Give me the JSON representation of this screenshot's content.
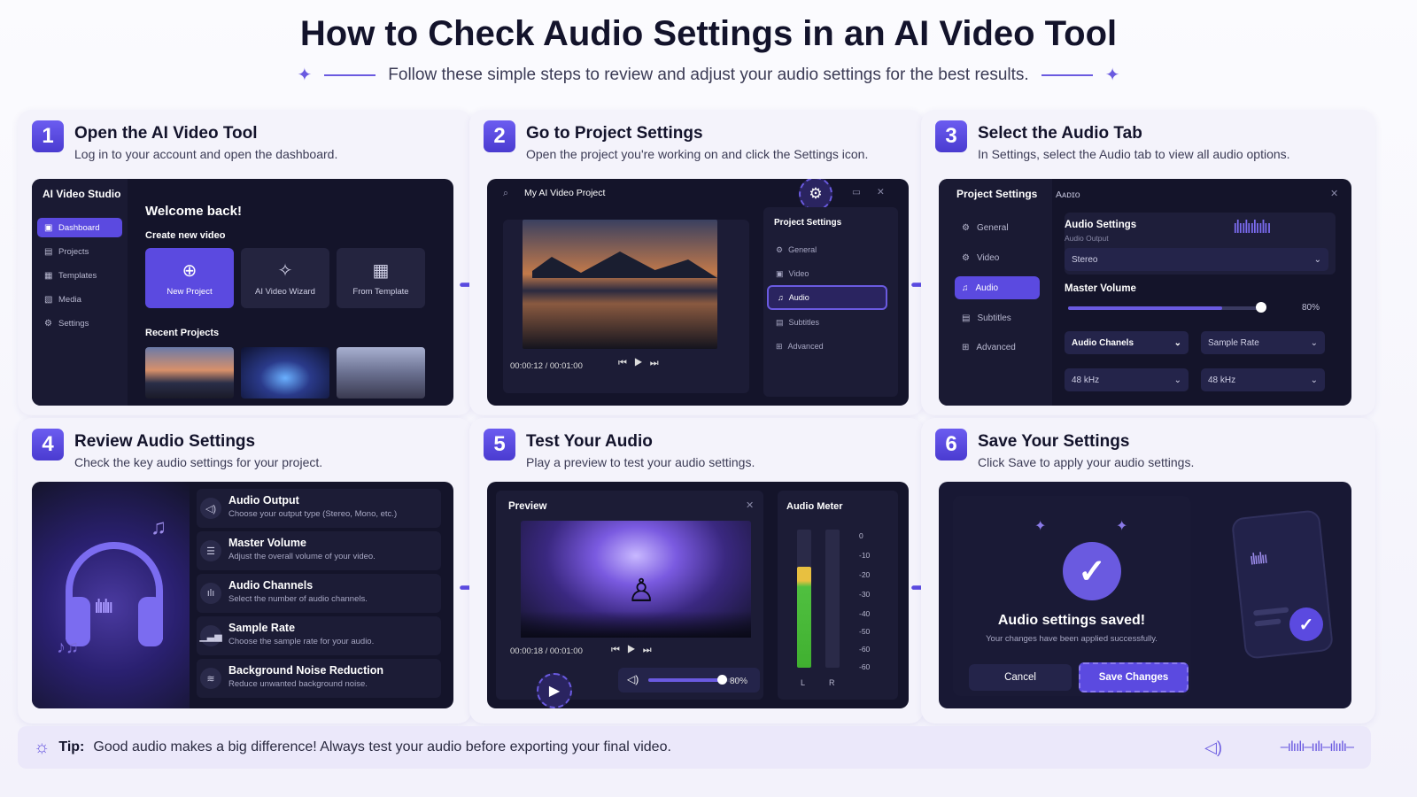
{
  "header": {
    "title": "How to Check Audio Settings in an AI Video Tool",
    "subtitle": "Follow these simple steps to review and adjust your audio settings for the best results."
  },
  "steps": [
    {
      "num": "1",
      "title": "Open the AI Video Tool",
      "desc": "Log in to your account and open the dashboard."
    },
    {
      "num": "2",
      "title": "Go to Project Settings",
      "desc": "Open the project you're working on and click the Settings icon."
    },
    {
      "num": "3",
      "title": "Select the Audio Tab",
      "desc": "In Settings, select the Audio tab to view all audio options."
    },
    {
      "num": "4",
      "title": "Review Audio Settings",
      "desc": "Check the key audio settings for your project."
    },
    {
      "num": "5",
      "title": "Test Your Audio",
      "desc": "Play a preview to test your audio settings."
    },
    {
      "num": "6",
      "title": "Save Your Settings",
      "desc": "Click Save to apply your audio settings."
    }
  ],
  "panel1": {
    "brand": "AI Video Studio",
    "nav": [
      "Dashboard",
      "Projects",
      "Templates",
      "Media",
      "Settings"
    ],
    "welcome": "Welcome back!",
    "create_label": "Create new video",
    "tiles": [
      "New Project",
      "AI Video Wizard",
      "From Template"
    ],
    "recent_label": "Recent Projects"
  },
  "panel2": {
    "project_title": "My AI Video Project",
    "time": "00:00:12 / 00:01:00",
    "settings_title": "Project Settings",
    "items": [
      "General",
      "Video",
      "Audio",
      "Subtitles",
      "Advanced"
    ]
  },
  "panel3": {
    "header": "Project Settings",
    "tab_title": "Aᴀᴅɪᴏ",
    "nav": [
      "General",
      "Video",
      "Audio",
      "Subtitles",
      "Advanced"
    ],
    "audio_settings": "Audio Settings",
    "audio_output_label": "Audio Output",
    "output_value": "Stereo",
    "master_volume": "Master Volume",
    "volume_value": "80%",
    "volume_level": 0.8,
    "channels_label": "Audio Chanels",
    "sample_rate_label": "Sample Rate",
    "channels_value": "48 kHz",
    "sample_rate_value": "48 kHz"
  },
  "panel4": {
    "rows": [
      {
        "title": "Audio Output",
        "desc": "Choose your output type (Stereo, Mono, etc.)"
      },
      {
        "title": "Master Volume",
        "desc": "Adjust the overall volume of your video."
      },
      {
        "title": "Audio Channels",
        "desc": "Select the number of audio channels."
      },
      {
        "title": "Sample Rate",
        "desc": "Choose the sample rate for your audio."
      },
      {
        "title": "Background Noise Reduction",
        "desc": "Reduce unwanted background noise."
      }
    ]
  },
  "panel5": {
    "preview_label": "Preview",
    "meter_label": "Audio Meter",
    "time": "00:00:18 / 00:01:00",
    "volume_value": "80%",
    "volume_level": 0.8,
    "db_ticks": [
      "0",
      "-10",
      "-20",
      "-30",
      "-40",
      "-50",
      "-60",
      "-60"
    ],
    "channels": [
      "L",
      "R"
    ]
  },
  "panel6": {
    "saved_title": "Audio settings saved!",
    "saved_desc": "Your changes have been applied successfully.",
    "cancel": "Cancel",
    "save": "Save Changes"
  },
  "tip": {
    "label": "Tip:",
    "text": "Good audio makes a big difference! Always test your audio before exporting your final video."
  },
  "colors": {
    "accent": "#5b4ae0",
    "panel": "#14142a"
  }
}
